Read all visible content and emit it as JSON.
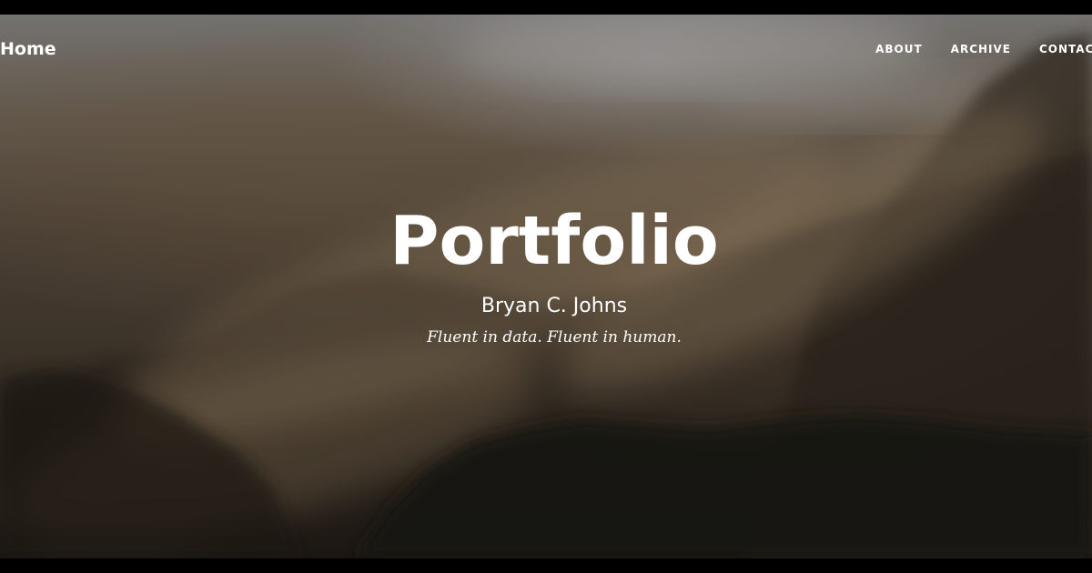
{
  "nav": {
    "brand": "Home",
    "links": [
      {
        "label": "About"
      },
      {
        "label": "Archive"
      },
      {
        "label": "Contact"
      }
    ]
  },
  "hero": {
    "title": "Portfolio",
    "subtitle": "Bryan C. Johns",
    "tagline": "Fluent in data. Fluent in human."
  },
  "colors": {
    "text": "#ffffff",
    "letterbox": "#000000"
  }
}
